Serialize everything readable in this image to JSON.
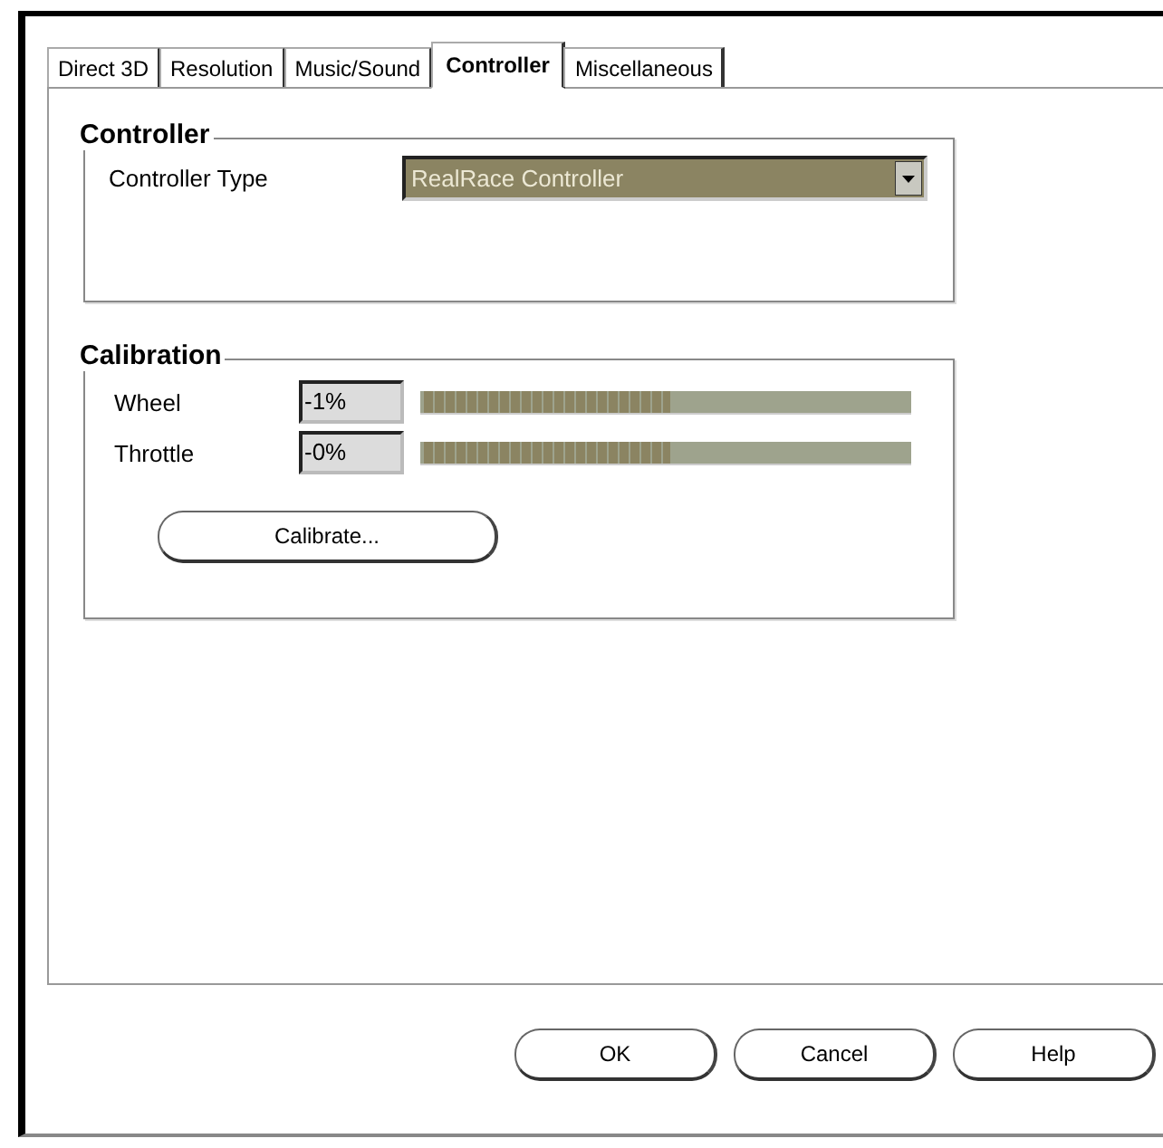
{
  "tabs": [
    {
      "label": "Direct 3D",
      "selected": false
    },
    {
      "label": "Resolution",
      "selected": false
    },
    {
      "label": "Music/Sound",
      "selected": false
    },
    {
      "label": "Controller",
      "selected": true
    },
    {
      "label": "Miscellaneous",
      "selected": false
    }
  ],
  "controller_group": {
    "title": "Controller",
    "label": "Controller Type",
    "value": "RealRace Controller"
  },
  "calibration_group": {
    "title": "Calibration",
    "axes": [
      {
        "name": "Wheel",
        "reading": "-1%",
        "level": 0.5
      },
      {
        "name": "Throttle",
        "reading": "-0%",
        "level": 0.5
      }
    ],
    "button": "Calibrate..."
  },
  "buttons": [
    "OK",
    "Cancel",
    "Help"
  ]
}
